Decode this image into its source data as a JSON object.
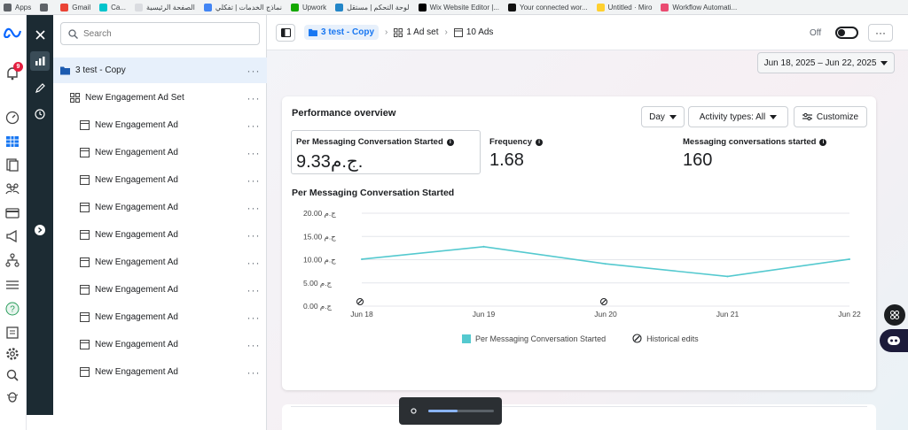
{
  "bookmarks": [
    {
      "label": "Apps",
      "icon": "apps-grid-icon",
      "color": "#5f6368"
    },
    {
      "label": "",
      "icon": "grid-icon",
      "color": "#5f6368"
    },
    {
      "label": "Gmail",
      "icon": "gmail-icon",
      "color": "#ea4335"
    },
    {
      "label": "Ca...",
      "icon": "canva-icon",
      "color": "#00c4cc"
    },
    {
      "label": "الصفحة الرئيسية",
      "icon": "page-icon",
      "color": "#dadce0"
    },
    {
      "label": "نماذج الخدمات | تفكلي",
      "icon": "tafkly-icon",
      "color": "#4285f4"
    },
    {
      "label": "Upwork",
      "icon": "upwork-icon",
      "color": "#14a800"
    },
    {
      "label": "لوحة التحكم | مستقل",
      "icon": "mostaql-icon",
      "color": "#2386c8"
    },
    {
      "label": "Wix Website Editor |...",
      "icon": "wix-icon",
      "color": "#000000"
    },
    {
      "label": "Your connected wor...",
      "icon": "notion-icon",
      "color": "#111111"
    },
    {
      "label": "Untitled · Miro",
      "icon": "miro-icon",
      "color": "#ffd02f"
    },
    {
      "label": "Workflow Automati...",
      "icon": "workflow-icon",
      "color": "#ea4b71"
    }
  ],
  "rail": {
    "notification_count": "9",
    "icons": [
      "meta-icon",
      "notification-icon",
      "speedometer-icon",
      "table-icon",
      "pages-icon",
      "audience-icon",
      "billing-icon",
      "megaphone-icon",
      "hierarchy-icon",
      "menu-icon",
      "help-icon",
      "reports-icon",
      "settings-icon",
      "search-icon",
      "bug-icon"
    ]
  },
  "tree": {
    "search_placeholder": "Search",
    "campaign": "3 test - Copy",
    "adset": "New Engagement Ad Set",
    "ads": [
      "New Engagement Ad",
      "New Engagement Ad",
      "New Engagement Ad",
      "New Engagement Ad",
      "New Engagement Ad",
      "New Engagement Ad",
      "New Engagement Ad",
      "New Engagement Ad",
      "New Engagement Ad",
      "New Engagement Ad"
    ],
    "more": "···"
  },
  "topbar": {
    "crumb_campaign": "3 test - Copy",
    "crumb_adset": "1 Ad set",
    "crumb_ads": "10 Ads",
    "toggle_label": "Off",
    "more": "···"
  },
  "date_range": "Jun 18, 2025 – Jun 22, 2025",
  "overview": {
    "title": "Performance overview",
    "day_label": "Day",
    "activity_label": "Activity types: All",
    "customize_label": "Customize",
    "metrics": [
      {
        "label": "Per Messaging Conversation Started",
        "value": "9.33ج.م."
      },
      {
        "label": "Frequency",
        "value": "1.68"
      },
      {
        "label": "Messaging conversations started",
        "value": "160"
      }
    ],
    "chart_title": "Per Messaging Conversation Started",
    "legend_series": "Per Messaging Conversation Started",
    "legend_edits": "Historical edits"
  },
  "chart_data": {
    "type": "line",
    "title": "Per Messaging Conversation Started",
    "x": [
      "Jun 18",
      "Jun 19",
      "Jun 20",
      "Jun 21",
      "Jun 22"
    ],
    "series": [
      {
        "name": "Per Messaging Conversation Started",
        "values": [
          10.1,
          12.8,
          9.1,
          6.4,
          10.1
        ],
        "color": "#54c9cf"
      }
    ],
    "yticks": [
      "0.00 ج.م",
      "5.00 ج.م",
      "10.00 ج.م",
      "15.00 ج.م",
      "20.00 ج.م"
    ],
    "ylim": [
      0,
      20
    ],
    "historical_edits": [
      "Jun 18",
      "Jun 20"
    ],
    "grid": true,
    "legend": "bottom"
  }
}
